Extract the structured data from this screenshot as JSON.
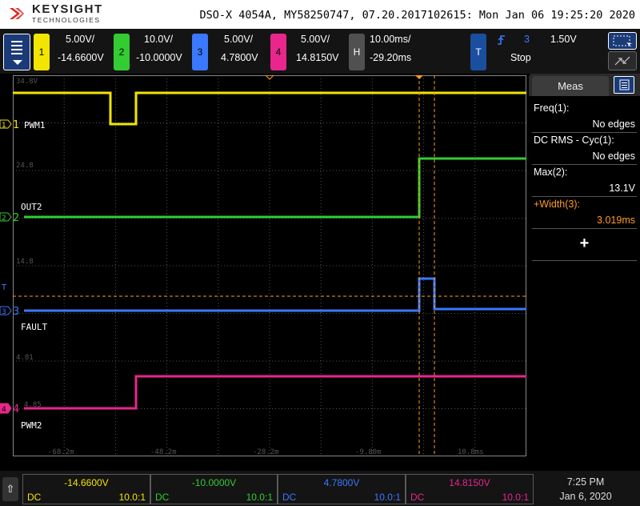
{
  "header": {
    "brand": "KEYSIGHT",
    "brand_sub": "TECHNOLOGIES",
    "title": "DSO-X 4054A, MY58250747, 07.20.2017102615: Mon Jan 06 19:25:20 2020"
  },
  "channels": [
    {
      "id": "1",
      "scale": "5.00V/",
      "offset": "-14.6600V",
      "color": "#f2e600",
      "label": "PWM1",
      "coupling": "DC",
      "probe": "10.0:1"
    },
    {
      "id": "2",
      "scale": "10.0V/",
      "offset": "-10.0000V",
      "color": "#33cc33",
      "label": "OUT2",
      "coupling": "DC",
      "probe": "10.0:1"
    },
    {
      "id": "3",
      "scale": "5.00V/",
      "offset": "4.7800V",
      "color": "#3a78ff",
      "label": "FAULT",
      "coupling": "DC",
      "probe": "10.0:1"
    },
    {
      "id": "4",
      "scale": "5.00V/",
      "offset": "14.8150V",
      "color": "#e8268c",
      "label": "PWM2",
      "coupling": "DC",
      "probe": "10.0:1"
    }
  ],
  "horizontal": {
    "label": "H",
    "scale": "10.00ms/",
    "delay": "-29.20ms"
  },
  "trigger": {
    "label": "T",
    "source": "3",
    "level": "1.50V",
    "status": "Stop"
  },
  "grid_labels": {
    "v_labels": [
      "34.8V",
      "24.8",
      "14.8",
      "4.81",
      "4.85"
    ],
    "t_labels": [
      "-68.2m",
      "-48.2m",
      "-28.2m",
      "-9.80m",
      "10.8ms"
    ]
  },
  "meas": {
    "tab": "Meas",
    "items": [
      {
        "name": "Freq(1):",
        "value": "No edges",
        "color": "#ffffff"
      },
      {
        "name": "DC RMS - Cyc(1):",
        "value": "No edges",
        "color": "#ffffff"
      },
      {
        "name": "Max(2):",
        "value": "13.1V",
        "color": "#ffffff"
      },
      {
        "name": "+Width(3):",
        "value": "3.019ms",
        "color": "#ff9b21"
      }
    ],
    "add_symbol": "+"
  },
  "status": {
    "time": "7:25 PM",
    "date": "Jan 6, 2020",
    "help_symbol": "⇧"
  },
  "colors": {
    "grid": "#555555",
    "cursor": "#ff9b21",
    "background": "#000000"
  }
}
